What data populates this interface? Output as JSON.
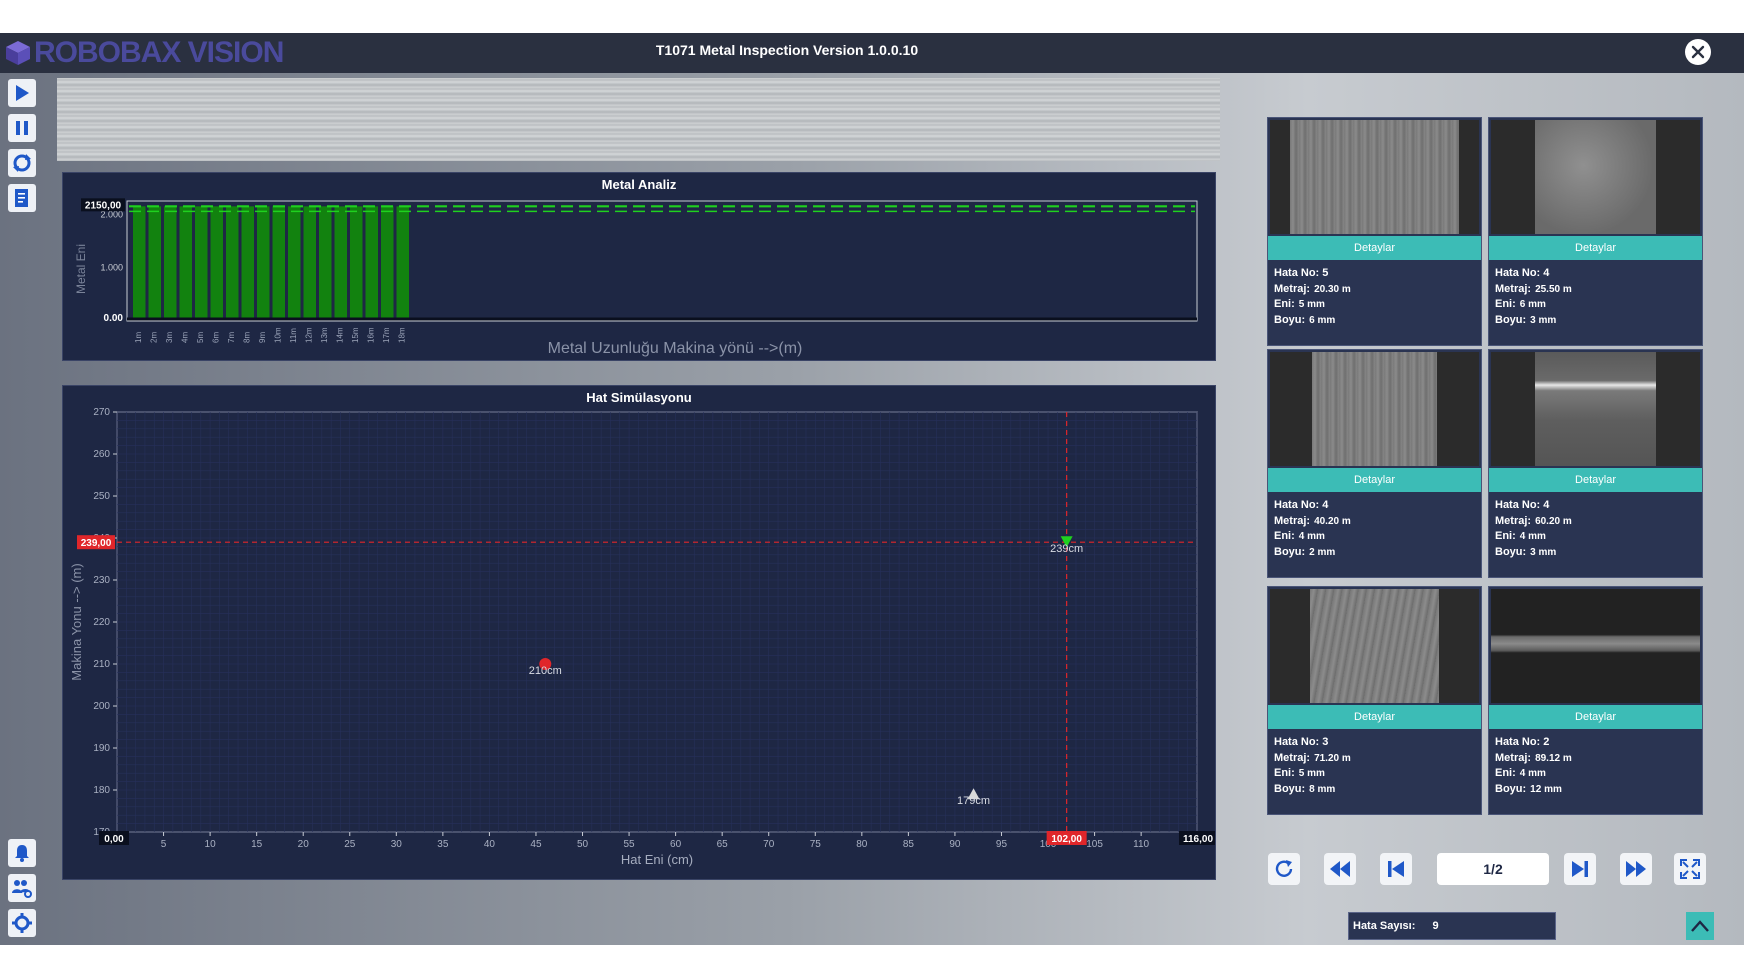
{
  "app": {
    "logo_text": "ROBOBAX VISION",
    "title": "T1071  Metal Inspection Version 1.0.0.10"
  },
  "colors": {
    "titlebar": "#2a3040",
    "panel": "#1e2744",
    "accent_teal": "#3cbcb6",
    "bar_green": "#12820f",
    "threshold_green": "#1fd11f",
    "crosshair_red": "#e0262a"
  },
  "toolbar": {
    "icons": [
      "play-icon",
      "pause-icon",
      "refresh-icon",
      "report-icon"
    ],
    "bottom_icons": [
      "bell-icon",
      "users-settings-icon",
      "gear-icon"
    ]
  },
  "metal_analiz": {
    "title": "Metal Analiz",
    "y_axis_label": "Metal Eni",
    "x_axis_label": "Metal Uzunluğu Makina yönü -->(m)",
    "top_value_label": "2150,00",
    "bottom_value_label": "0.00",
    "y_tick_labels": [
      "1.000",
      "2.000"
    ]
  },
  "hat_simulasyonu": {
    "title": "Hat Simülasyonu",
    "y_axis_label": "Makina Yonu --> (m)",
    "x_axis_label": "Hat Eni (cm)",
    "y_marker_label": "239,00",
    "x_marker_label": "102,00",
    "x_min_label": "0,00",
    "x_max_label": "116,00"
  },
  "chart_data": [
    {
      "type": "bar",
      "title": "Metal Analiz",
      "xlabel": "Metal Uzunluğu Makina yönü -->(m)",
      "ylabel": "Metal Eni",
      "categories": [
        "1m",
        "2m",
        "3m",
        "4m",
        "5m",
        "6m",
        "7m",
        "8m",
        "9m",
        "10m",
        "11m",
        "12m",
        "13m",
        "14m",
        "15m",
        "16m",
        "17m",
        "18m"
      ],
      "values": [
        2150,
        2150,
        2150,
        2150,
        2150,
        2150,
        2150,
        2150,
        2150,
        2150,
        2150,
        2150,
        2150,
        2150,
        2150,
        2150,
        2150,
        2150
      ],
      "ylim": [
        0,
        2250
      ],
      "y_ticks": [
        0,
        1000,
        2000
      ],
      "threshold": 2150,
      "x_slots": 70
    },
    {
      "type": "scatter",
      "title": "Hat Simülasyonu",
      "xlabel": "Hat Eni (cm)",
      "ylabel": "Makina Yonu --> (m)",
      "xlim": [
        0,
        116
      ],
      "ylim": [
        170,
        270
      ],
      "x_ticks": [
        5,
        10,
        15,
        20,
        25,
        30,
        35,
        40,
        45,
        50,
        55,
        60,
        65,
        70,
        75,
        80,
        85,
        90,
        95,
        100,
        105,
        110
      ],
      "y_ticks": [
        170,
        180,
        190,
        200,
        210,
        220,
        230,
        240,
        250,
        260,
        270
      ],
      "points": [
        {
          "x": 46,
          "y": 210,
          "label": "210cm",
          "marker": "circle",
          "color": "#e0262a"
        },
        {
          "x": 92,
          "y": 179,
          "label": "179cm",
          "marker": "triangle-up",
          "color": "#d8d8d8"
        },
        {
          "x": 102,
          "y": 239,
          "label": "239cm",
          "marker": "triangle-down",
          "color": "#1fd11f"
        }
      ],
      "crosshair": {
        "x": 102,
        "y": 239
      }
    }
  ],
  "defects": [
    {
      "button": "Detaylar",
      "hata_no_label": "Hata No:",
      "hata_no": "5",
      "metraj_label": "Metraj:",
      "metraj": "20.30 m",
      "eni_label": "Eni:",
      "eni": "5 mm",
      "boyu_label": "Boyu:",
      "boyu": "6 mm",
      "img": "streaks"
    },
    {
      "button": "Detaylar",
      "hata_no_label": "Hata No:",
      "hata_no": "4",
      "metraj_label": "Metraj:",
      "metraj": "25.50 m",
      "eni_label": "Eni:",
      "eni": "6 mm",
      "boyu_label": "Boyu:",
      "boyu": "3 mm",
      "img": "speckle"
    },
    {
      "button": "Detaylar",
      "hata_no_label": "Hata No:",
      "hata_no": "4",
      "metraj_label": "Metraj:",
      "metraj": "40.20 m",
      "eni_label": "Eni:",
      "eni": "4 mm",
      "boyu_label": "Boyu:",
      "boyu": "2 mm",
      "img": "plain"
    },
    {
      "button": "Detaylar",
      "hata_no_label": "Hata No:",
      "hata_no": "4",
      "metraj_label": "Metraj:",
      "metraj": "60.20 m",
      "eni_label": "Eni:",
      "eni": "4 mm",
      "boyu_label": "Boyu:",
      "boyu": "3 mm",
      "img": "glare"
    },
    {
      "button": "Detaylar",
      "hata_no_label": "Hata No:",
      "hata_no": "3",
      "metraj_label": "Metraj:",
      "metraj": "71.20 m",
      "eni_label": "Eni:",
      "eni": "5 mm",
      "boyu_label": "Boyu:",
      "boyu": "8 mm",
      "img": "streaks2"
    },
    {
      "button": "Detaylar",
      "hata_no_label": "Hata No:",
      "hata_no": "2",
      "metraj_label": "Metraj:",
      "metraj": "89.12 m",
      "eni_label": "Eni:",
      "eni": "4 mm",
      "boyu_label": "Boyu:",
      "boyu": "12 mm",
      "img": "band"
    }
  ],
  "pager": {
    "page": "1/2",
    "icons": [
      "refresh-icon",
      "fast-rewind-icon",
      "skip-first-icon",
      "skip-last-icon",
      "fast-forward-icon",
      "fullscreen-icon"
    ]
  },
  "status": {
    "hata_sayisi_label": "Hata Sayısı:",
    "hata_sayisi": "9"
  }
}
